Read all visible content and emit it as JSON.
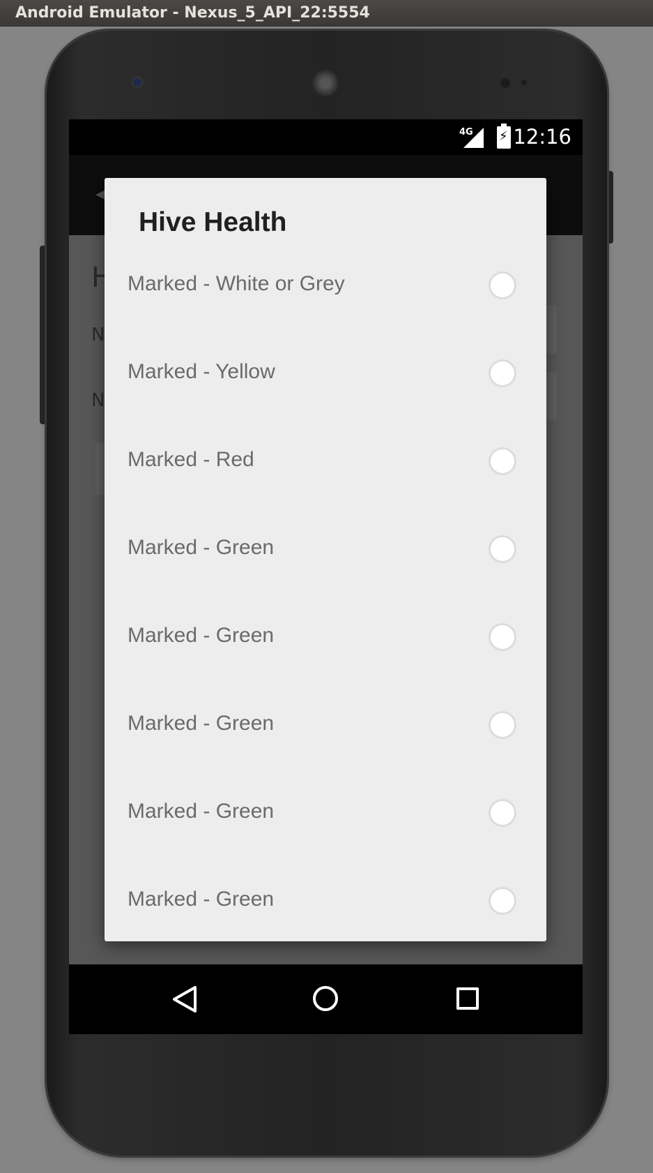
{
  "window": {
    "title": "Android Emulator - Nexus_5_API_22:5554"
  },
  "status_bar": {
    "network": "4G",
    "time": "12:16"
  },
  "background": {
    "heading_initial": "H",
    "label1_initial": "N",
    "label2_initial": "N"
  },
  "dialog": {
    "title": "Hive Health",
    "options": [
      {
        "label": "Marked - White or Grey",
        "selected": false
      },
      {
        "label": "Marked - Yellow",
        "selected": false
      },
      {
        "label": "Marked - Red",
        "selected": false
      },
      {
        "label": "Marked - Green",
        "selected": false
      },
      {
        "label": "Marked - Green",
        "selected": false
      },
      {
        "label": "Marked - Green",
        "selected": false
      },
      {
        "label": "Marked - Green",
        "selected": false
      },
      {
        "label": "Marked - Green",
        "selected": false
      }
    ]
  },
  "navigation": {
    "icons": [
      "back-icon",
      "home-icon",
      "recents-icon"
    ]
  }
}
